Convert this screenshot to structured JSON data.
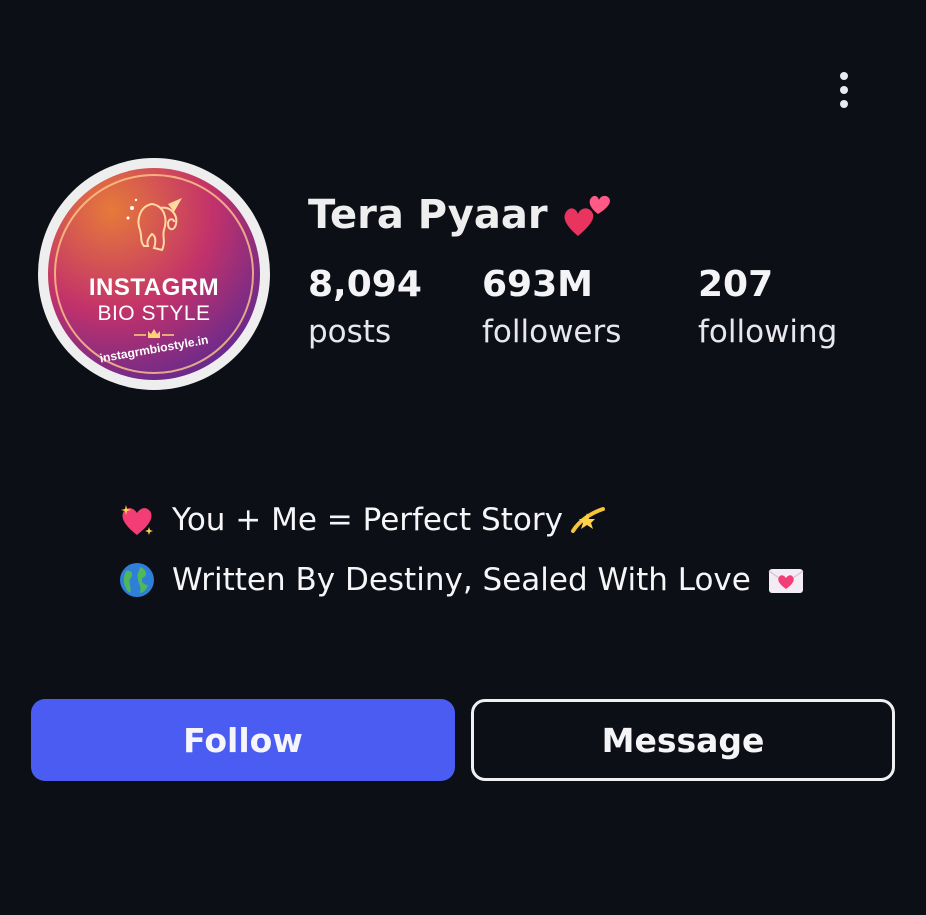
{
  "profile": {
    "name": "Tera Pyaar",
    "name_emoji_icon": "two-hearts-icon",
    "avatar": {
      "brand_line1": "INSTAGRM",
      "brand_line2": "BIO STYLE",
      "url": "instagrmbiostyle.in"
    }
  },
  "stats": {
    "posts": {
      "value": "8,094",
      "label": "posts"
    },
    "followers": {
      "value": "693M",
      "label": "followers"
    },
    "following": {
      "value": "207",
      "label": "following"
    }
  },
  "bio": {
    "lines": [
      {
        "leading_icon": "sparkling-heart-icon",
        "text": "You + Me = Perfect Story",
        "trailing_icon": "dizzy-star-icon"
      },
      {
        "leading_icon": "globe-icon",
        "text": "Written By Destiny, Sealed With Love",
        "trailing_icon": "love-letter-icon"
      }
    ]
  },
  "actions": {
    "follow_label": "Follow",
    "message_label": "Message"
  },
  "colors": {
    "background": "#0d0f17",
    "follow_button": "#4a5cf1",
    "text": "#f4f4f6"
  }
}
